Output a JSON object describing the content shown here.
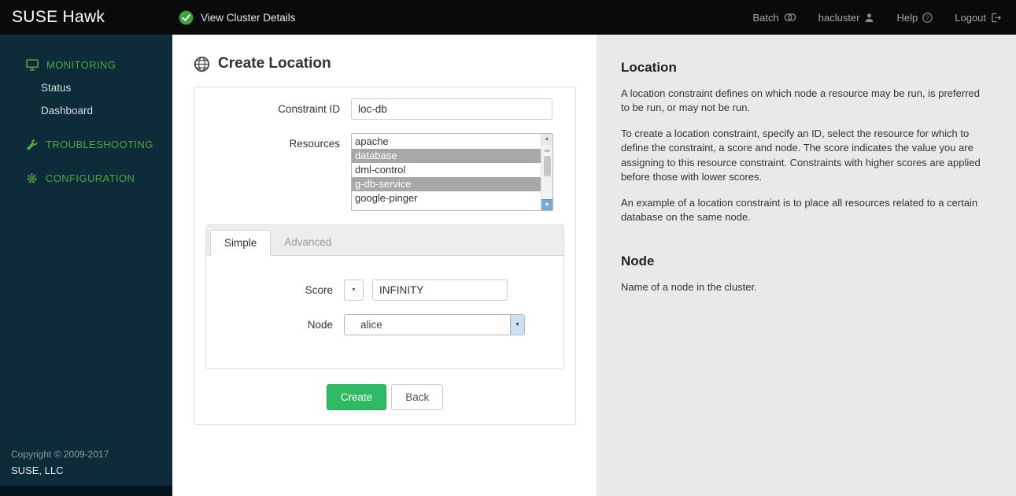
{
  "topbar": {
    "brand": "SUSE Hawk",
    "view_cluster_details": "View Cluster Details",
    "batch_label": "Batch",
    "username": "hacluster",
    "help_label": "Help",
    "logout_label": "Logout"
  },
  "sidebar": {
    "monitoring_label": "MONITORING",
    "monitoring_items": [
      {
        "label": "Status"
      },
      {
        "label": "Dashboard"
      }
    ],
    "troubleshooting_label": "TROUBLESHOOTING",
    "configuration_label": "CONFIGURATION",
    "copyright": "Copyright © 2009-2017",
    "company": "SUSE, LLC"
  },
  "page": {
    "title": "Create Location"
  },
  "form": {
    "constraint_id": {
      "label": "Constraint ID",
      "value": "loc-db"
    },
    "resources": {
      "label": "Resources",
      "options": [
        {
          "name": "apache",
          "selected": false
        },
        {
          "name": "database",
          "selected": true
        },
        {
          "name": "dml-control",
          "selected": false
        },
        {
          "name": "g-db-service",
          "selected": true
        },
        {
          "name": "google-pinger",
          "selected": false
        }
      ]
    },
    "tabs": {
      "simple": "Simple",
      "advanced": "Advanced",
      "active": "Simple"
    },
    "score": {
      "label": "Score",
      "value": "INFINITY"
    },
    "node": {
      "label": "Node",
      "value": "alice"
    },
    "buttons": {
      "create": "Create",
      "back": "Back"
    }
  },
  "help": {
    "location_heading": "Location",
    "location_paragraphs": [
      "A location constraint defines on which node a resource may be run, is preferred to be run, or may not be run.",
      "To create a location constraint, specify an ID, select the resource for which to define the constraint, a score and node. The score indicates the value you are assigning to this resource constraint. Constraints with higher scores are applied before those with lower scores.",
      "An example of a location constraint is to place all resources related to a certain database on the same node."
    ],
    "node_heading": "Node",
    "node_paragraph": "Name of a node in the cluster."
  },
  "glyphs": {
    "caret_down": "▼",
    "scroll_up": "▲",
    "scroll_down": "▼"
  },
  "colors": {
    "topbar_bg": "#0a0a0a",
    "sidebar_bg": "#0d2b38",
    "sidebar_green": "#4fa83d",
    "create_button_green": "#2eb963",
    "cluster_ok_green": "#3aa53a",
    "help_panel_bg": "#e9e9e9",
    "selected_option_bg": "#a8a8a8"
  }
}
